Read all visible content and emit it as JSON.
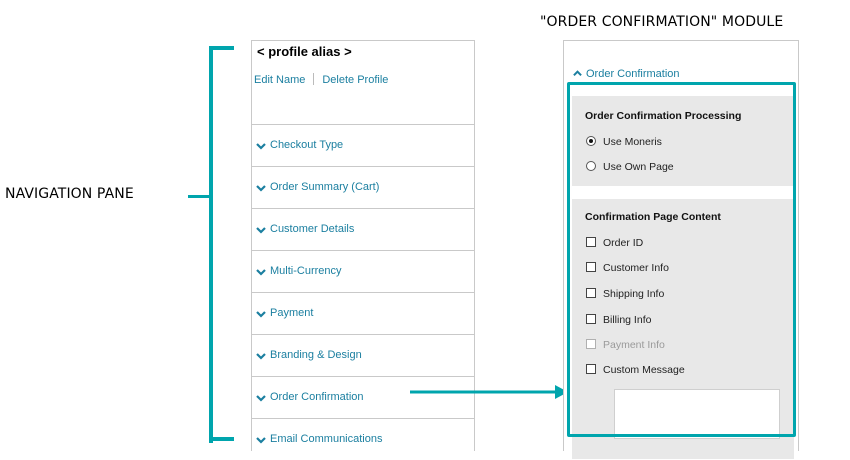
{
  "callouts": {
    "module": "\"ORDER CONFIRMATION\" MODULE",
    "nav": "NAVIGATION PANE"
  },
  "nav_pane": {
    "profile_alias": "< profile alias >",
    "edit_name": "Edit Name",
    "delete_profile": "Delete Profile",
    "items": [
      {
        "label": "Checkout Type"
      },
      {
        "label": "Order Summary (Cart)"
      },
      {
        "label": "Customer Details"
      },
      {
        "label": "Multi-Currency"
      },
      {
        "label": "Payment"
      },
      {
        "label": "Branding & Design"
      },
      {
        "label": "Order Confirmation"
      },
      {
        "label": "Email Communications"
      }
    ]
  },
  "module": {
    "header": "Order Confirmation",
    "processing": {
      "title": "Order Confirmation Processing",
      "options": [
        {
          "label": "Use Moneris",
          "selected": true
        },
        {
          "label": "Use Own Page",
          "selected": false
        }
      ]
    },
    "content": {
      "title": "Confirmation Page Content",
      "options": [
        {
          "label": "Order ID",
          "checked": false,
          "disabled": false
        },
        {
          "label": "Customer Info",
          "checked": false,
          "disabled": false
        },
        {
          "label": "Shipping Info",
          "checked": false,
          "disabled": false
        },
        {
          "label": "Billing Info",
          "checked": false,
          "disabled": false
        },
        {
          "label": "Payment Info",
          "checked": false,
          "disabled": true
        },
        {
          "label": "Custom Message",
          "checked": false,
          "disabled": false
        }
      ]
    }
  },
  "colors": {
    "accent": "#00a5ad",
    "link": "#1b7fa0",
    "panel_bg": "#e8e8e8"
  },
  "icons": [
    "chevron-down-icon",
    "chevron-up-icon",
    "radio-icon",
    "checkbox-icon",
    "arrow-icon"
  ]
}
